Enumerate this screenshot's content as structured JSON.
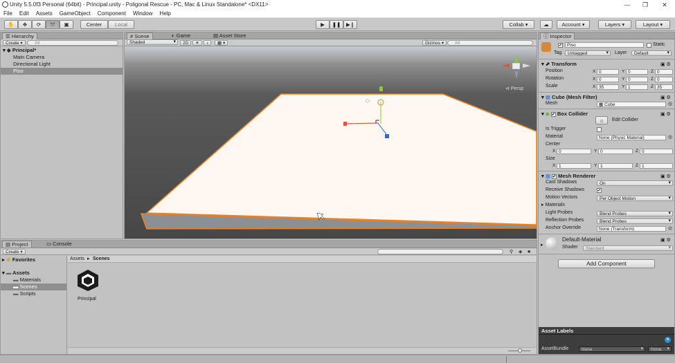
{
  "window": {
    "title": "Unity 5.5.0f3 Personal (64bit) - Principal.unity - Poligonal Rescue - PC, Mac & Linux Standalone* <DX11>",
    "minimize": "—",
    "maximize": "❐",
    "close": "✕"
  },
  "menu": [
    "File",
    "Edit",
    "Assets",
    "GameObject",
    "Component",
    "Window",
    "Help"
  ],
  "toolbar": {
    "pivot_center": "Center",
    "pivot_local": "Local",
    "collab": "Collab ▾",
    "account": "Account ▾",
    "layers": "Layers ▾",
    "layout": "Layout ▾"
  },
  "hierarchy": {
    "tab": "Hierarchy",
    "create": "Create ▾",
    "search_placeholder": "All",
    "scene_name": "Principal*",
    "items": [
      "Main Camera",
      "Directional Light",
      "Piso"
    ]
  },
  "scene": {
    "tabs": [
      "Scene",
      "Game",
      "Asset Store"
    ],
    "shading": "Shaded",
    "mode_2d": "2D",
    "gizmos": "Gizmos ▾",
    "search_placeholder": "All",
    "persp_label": "Persp"
  },
  "project": {
    "tabs": [
      "Project",
      "Console"
    ],
    "create": "Create ▾",
    "favorites": "Favorites",
    "assets": "Assets",
    "folders": [
      "Materials",
      "Scenes",
      "Scripts"
    ],
    "breadcrumb": [
      "Assets",
      "Scenes"
    ],
    "asset_items": [
      "Principal"
    ]
  },
  "inspector": {
    "tab": "Inspector",
    "object_name": "Piso",
    "static_label": "Static",
    "tag_label": "Tag",
    "tag_value": "Untagged",
    "layer_label": "Layer",
    "layer_value": "Default",
    "transform": {
      "title": "Transform",
      "position_label": "Position",
      "position": [
        "0",
        "0",
        "0"
      ],
      "rotation_label": "Rotation",
      "rotation": [
        "0",
        "0",
        "0"
      ],
      "scale_label": "Scale",
      "scale": [
        "35",
        "1",
        "35"
      ]
    },
    "mesh_filter": {
      "title": "Cube (Mesh Filter)",
      "mesh_label": "Mesh",
      "mesh_value": "Cube"
    },
    "box_collider": {
      "title": "Box Collider",
      "edit_label": "Edit Collider",
      "is_trigger_label": "Is Trigger",
      "material_label": "Material",
      "material_value": "None (Physic Material)",
      "center_label": "Center",
      "center": [
        "0",
        "0",
        "0"
      ],
      "size_label": "Size",
      "size": [
        "1",
        "1",
        "1"
      ]
    },
    "mesh_renderer": {
      "title": "Mesh Renderer",
      "cast_shadows_label": "Cast Shadows",
      "cast_shadows_value": "On",
      "receive_shadows_label": "Receive Shadows",
      "motion_vectors_label": "Motion Vectors",
      "motion_vectors_value": "Per Object Motion",
      "materials_label": "Materials",
      "light_probes_label": "Light Probes",
      "light_probes_value": "Blend Probes",
      "reflection_probes_label": "Reflection Probes",
      "reflection_probes_value": "Blend Probes",
      "anchor_override_label": "Anchor Override",
      "anchor_override_value": "None (Transform)"
    },
    "material": {
      "name": "Default-Material",
      "shader_label": "Shader",
      "shader_value": "Standard"
    },
    "add_component": "Add Component",
    "asset_labels": "Asset Labels",
    "asset_bundle_label": "AssetBundle",
    "asset_bundle_value": "None",
    "asset_bundle_variant": "None"
  },
  "xyz": [
    "X",
    "Y",
    "Z"
  ],
  "colors": {
    "selection_outline": "#f07f1b",
    "plane_top": "#fff8f2",
    "viewport_sky": "#c8ccd2",
    "viewport_ground": "#4a4a4a"
  }
}
